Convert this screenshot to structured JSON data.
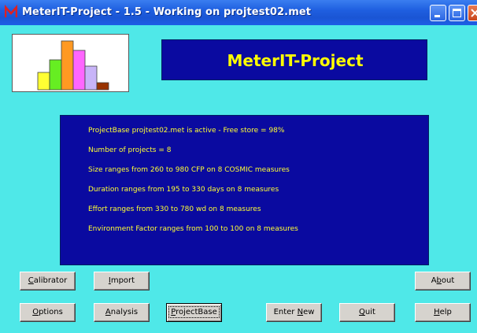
{
  "window": {
    "title": "MeterIT-Project - 1.5 - Working on projtest02.met"
  },
  "colors": {
    "client_bg": "#4fe8e8",
    "panel_bg": "#0a0aa0",
    "panel_text": "#ffff33",
    "titlebar": "#1f5fe0"
  },
  "banner": {
    "title": "MeterIT-Project"
  },
  "logo": {
    "icon": "histogram-logo",
    "bars": [
      {
        "color": "#ffff33",
        "level": 0.33
      },
      {
        "color": "#66ee22",
        "level": 0.57
      },
      {
        "color": "#ff9922",
        "level": 0.94
      },
      {
        "color": "#ff66ff",
        "level": 0.76
      },
      {
        "color": "#c8b4f8",
        "level": 0.45
      },
      {
        "color": "#993300",
        "level": 0.13
      }
    ]
  },
  "info": {
    "lines": [
      "ProjectBase projtest02.met is active - Free store = 98%",
      "Number of projects = 8",
      "Size ranges from 260 to 980 CFP on 8 COSMIC measures",
      "Duration ranges from 195 to 330 days on 8 measures",
      "Effort ranges from 330 to 780 wd on 8 measures",
      "Environment Factor ranges from 100 to 100 on 8 measures"
    ]
  },
  "buttons": {
    "calibrator": {
      "first": "C",
      "rest": "alibrator"
    },
    "import": {
      "first": "I",
      "rest": "mport"
    },
    "about": {
      "pre": "A",
      "u": "b",
      "post": "out"
    },
    "options": {
      "first": "O",
      "rest": "ptions"
    },
    "analysis": {
      "first": "A",
      "rest": "nalysis"
    },
    "projectbase": {
      "first": "P",
      "rest": "rojectBase"
    },
    "enter_new": {
      "pre": "Enter ",
      "u": "N",
      "post": "ew"
    },
    "quit": {
      "first": "Q",
      "rest": "uit"
    },
    "help": {
      "first": "H",
      "rest": "elp"
    }
  }
}
